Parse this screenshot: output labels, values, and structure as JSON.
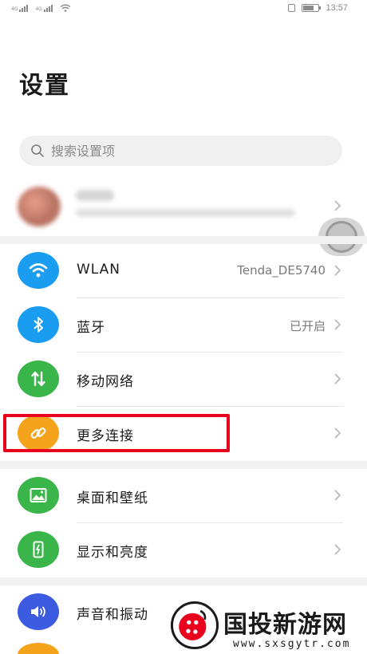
{
  "status_bar": {
    "time": "13:57",
    "sim1_tag": "4G",
    "sim2_tag": "4G"
  },
  "page_title": "设置",
  "search": {
    "placeholder": "搜索设置项",
    "icon": "search-icon"
  },
  "account": {
    "blurred": true
  },
  "colors": {
    "wlan": "#1a9cf0",
    "bluetooth": "#1a9cf0",
    "mobile": "#3ab54a",
    "more": "#f5a31a",
    "wallpaper": "#3ab54a",
    "display": "#3ab54a",
    "sound": "#3d5be0",
    "highlight": "#e8001c"
  },
  "group1": [
    {
      "label": "WLAN",
      "value": "Tenda_DE5740",
      "icon": "wifi-icon"
    },
    {
      "label": "蓝牙",
      "value": "已开启",
      "icon": "bluetooth-icon"
    },
    {
      "label": "移动网络",
      "value": "",
      "icon": "mobile-data-icon"
    },
    {
      "label": "更多连接",
      "value": "",
      "icon": "link-icon"
    }
  ],
  "group2": [
    {
      "label": "桌面和壁纸",
      "icon": "image-icon"
    },
    {
      "label": "显示和亮度",
      "icon": "display-icon"
    }
  ],
  "group3": [
    {
      "label": "声音和振动",
      "icon": "speaker-icon"
    }
  ],
  "watermark": {
    "title": "国投新游网",
    "url": "www.sxsgytr.com"
  }
}
